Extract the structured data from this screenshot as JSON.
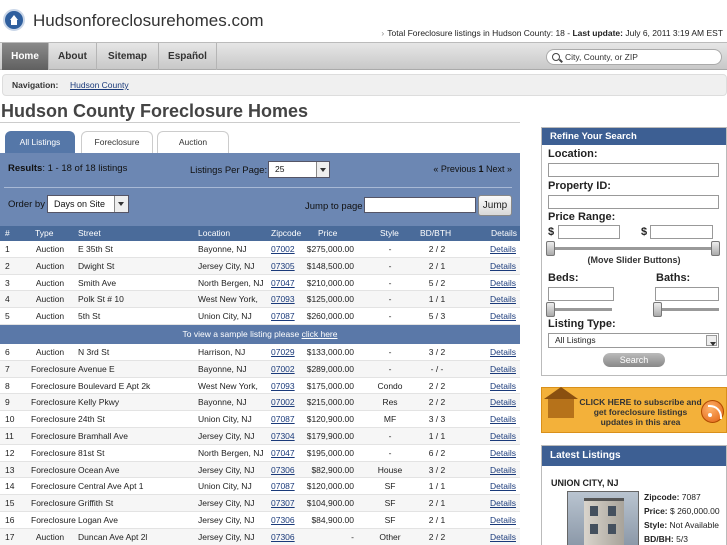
{
  "header": {
    "site_title": "Hudsonforeclosurehomes.com",
    "info_prefix": "Total Foreclosure listings in Hudson County: 18 - ",
    "info_update_label": "Last update:",
    "info_update_value": " July 6, 2011 3:19 AM EST"
  },
  "nav": {
    "home": "Home",
    "about": "About",
    "sitemap": "Sitemap",
    "espanol": "Español",
    "search_placeholder": "City, County, or ZIP"
  },
  "breadcrumb": {
    "label": "Navigation:",
    "link": "Hudson County"
  },
  "page_title": "Hudson County Foreclosure Homes",
  "tabs": [
    "All Listings",
    "Foreclosure",
    "Auction"
  ],
  "results": {
    "label": "Results",
    "range": ": 1 - 18 of 18 listings",
    "per_page_label": "Listings Per Page:",
    "per_page_value": "25",
    "prev": "« Previous",
    "page": "1",
    "next": "Next »",
    "order_label": "Order by",
    "order_value": "Days on Site",
    "jump_label": "Jump to page",
    "jump_button": "Jump"
  },
  "table": {
    "headers": [
      "#",
      "Type",
      "Street",
      "Location",
      "Zipcode",
      "Price",
      "Style",
      "BD/BTH",
      "Details"
    ],
    "rows_top": [
      [
        "1",
        "Auction",
        "E 35th St",
        "Bayonne, NJ",
        "07002",
        "$275,000.00",
        "-",
        "2 / 2",
        "Details"
      ],
      [
        "2",
        "Auction",
        "Dwight St",
        "Jersey City, NJ",
        "07305",
        "$148,500.00",
        "-",
        "2 / 1",
        "Details"
      ],
      [
        "3",
        "Auction",
        "Smith Ave",
        "North Bergen, NJ",
        "07047",
        "$210,000.00",
        "-",
        "5 / 2",
        "Details"
      ],
      [
        "4",
        "Auction",
        "Polk St # 10",
        "West New York,",
        "07093",
        "$125,000.00",
        "-",
        "1 / 1",
        "Details"
      ],
      [
        "5",
        "Auction",
        "5th St",
        "Union City, NJ",
        "07087",
        "$260,000.00",
        "-",
        "5 / 3",
        "Details"
      ]
    ],
    "sample_text": "To view a sample listing please ",
    "sample_link": "click here",
    "rows_bottom": [
      [
        "6",
        "Auction",
        "N 3rd St",
        "Harrison, NJ",
        "07029",
        "$133,000.00",
        "-",
        "3 / 2",
        "Details"
      ],
      [
        "7",
        "Foreclosure",
        "Avenue E",
        "Bayonne, NJ",
        "07002",
        "$289,000.00",
        "-",
        "- / -",
        "Details"
      ],
      [
        "8",
        "Foreclosure",
        "Boulevard E Apt 2k",
        "West New York,",
        "07093",
        "$175,000.00",
        "Condo",
        "2 / 2",
        "Details"
      ],
      [
        "9",
        "Foreclosure",
        "Kelly Pkwy",
        "Bayonne, NJ",
        "07002",
        "$215,000.00",
        "Res",
        "2 / 2",
        "Details"
      ],
      [
        "10",
        "Foreclosure",
        "24th St",
        "Union City, NJ",
        "07087",
        "$120,900.00",
        "MF",
        "3 / 3",
        "Details"
      ],
      [
        "11",
        "Foreclosure",
        "Bramhall Ave",
        "Jersey City, NJ",
        "07304",
        "$179,900.00",
        "-",
        "1 / 1",
        "Details"
      ],
      [
        "12",
        "Foreclosure",
        "81st St",
        "North Bergen, NJ",
        "07047",
        "$195,000.00",
        "-",
        "6 / 2",
        "Details"
      ],
      [
        "13",
        "Foreclosure",
        "Ocean Ave",
        "Jersey City, NJ",
        "07306",
        "$82,900.00",
        "House",
        "3 / 2",
        "Details"
      ],
      [
        "14",
        "Foreclosure",
        "Central Ave Apt 1",
        "Union City, NJ",
        "07087",
        "$120,000.00",
        "SF",
        "1 / 1",
        "Details"
      ],
      [
        "15",
        "Foreclosure",
        "Griffith St",
        "Jersey City, NJ",
        "07307",
        "$104,900.00",
        "SF",
        "2 / 1",
        "Details"
      ],
      [
        "16",
        "Foreclosure",
        "Logan Ave",
        "Jersey City, NJ",
        "07306",
        "$84,900.00",
        "SF",
        "2 / 1",
        "Details"
      ],
      [
        "17",
        "Auction",
        "Duncan Ave Apt 2l",
        "Jersey City, NJ",
        "07306",
        "-",
        "Other",
        "2 / 2",
        "Details"
      ]
    ]
  },
  "refine": {
    "title": "Refine Your Search",
    "location": "Location:",
    "property_id": "Property ID:",
    "price_range": "Price Range:",
    "currency": "$",
    "slider_note": "(Move Slider Buttons)",
    "beds": "Beds:",
    "baths": "Baths:",
    "listing_type": "Listing Type:",
    "listing_type_value": "All Listings",
    "search_button": "Search"
  },
  "promo": {
    "text": "CLICK HERE to subscribe and get foreclosure listings updates in this area"
  },
  "latest": {
    "title": "Latest Listings",
    "city": "UNION CITY, NJ",
    "zipcode_label": "Zipcode:",
    "zipcode": " 7087",
    "price_label": "Price:",
    "price": " $ 260,000.00",
    "style_label": "Style:",
    "style": " Not Available",
    "bdbth_label": "BD/BH:",
    "bdbth": " 5/3"
  },
  "colors": {
    "accent": "#3d5f93",
    "panel": "#6c87b3",
    "promo": "#f3b13a"
  }
}
